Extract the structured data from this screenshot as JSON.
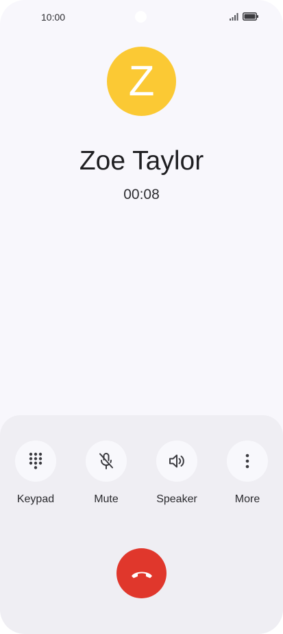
{
  "status_bar": {
    "time": "10:00",
    "icons": [
      "signal-icon",
      "battery-icon"
    ]
  },
  "caller": {
    "initial": "Z",
    "name": "Zoe Taylor",
    "duration": "00:08",
    "avatar_color": "#fbc934"
  },
  "controls": [
    {
      "label": "Keypad",
      "icon": "keypad-icon"
    },
    {
      "label": "Mute",
      "icon": "mic-off-icon"
    },
    {
      "label": "Speaker",
      "icon": "speaker-icon"
    },
    {
      "label": "More",
      "icon": "more-vert-icon"
    }
  ],
  "end_call": {
    "icon": "end-call-icon",
    "color": "#e0372c"
  }
}
